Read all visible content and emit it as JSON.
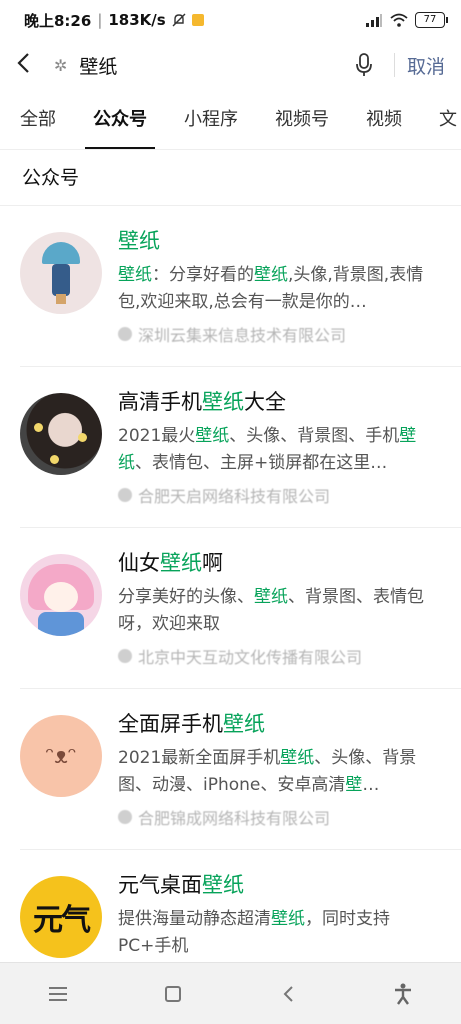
{
  "status_bar": {
    "time": "晚上8:26",
    "network_speed": "183K/s",
    "battery": "77"
  },
  "search": {
    "query": "壁纸",
    "cancel_label": "取消"
  },
  "tabs": [
    {
      "label": "全部",
      "active": false
    },
    {
      "label": "公众号",
      "active": true
    },
    {
      "label": "小程序",
      "active": false
    },
    {
      "label": "视频号",
      "active": false
    },
    {
      "label": "视频",
      "active": false
    },
    {
      "label": "文",
      "active": false
    }
  ],
  "section_title": "公众号",
  "results": [
    {
      "title_pre": "",
      "title_hl": "壁纸",
      "title_post": "",
      "desc_html_parts": [
        [
          "",
          "壁纸"
        ],
        [
          "：分享好看的",
          "壁纸"
        ],
        [
          ",头像,背景图,表情包,欢迎来取,总会有一款是你的…",
          ""
        ]
      ],
      "org": "深圳云集来信息技术有限公司"
    },
    {
      "title_pre": "高清手机",
      "title_hl": "壁纸",
      "title_post": "大全",
      "desc_html_parts": [
        [
          "2021最火",
          "壁纸"
        ],
        [
          "、头像、背景图、手机",
          "壁纸"
        ],
        [
          "、表情包、主屏+锁屏都在这里…",
          ""
        ]
      ],
      "org": "合肥天启网络科技有限公司"
    },
    {
      "title_pre": "仙女",
      "title_hl": "壁纸",
      "title_post": "啊",
      "desc_html_parts": [
        [
          "分享美好的头像、",
          "壁纸"
        ],
        [
          "、背景图、表情包呀，欢迎来取",
          ""
        ]
      ],
      "org": "北京中天互动文化传播有限公司"
    },
    {
      "title_pre": "全面屏手机",
      "title_hl": "壁纸",
      "title_post": "",
      "desc_html_parts": [
        [
          "2021最新全面屏手机",
          "壁纸"
        ],
        [
          "、头像、背景图、动漫、iPhone、安卓高清",
          "壁"
        ],
        [
          "…",
          ""
        ]
      ],
      "org": "合肥锦成网络科技有限公司"
    },
    {
      "title_pre": "元气桌面",
      "title_hl": "壁纸",
      "title_post": "",
      "desc_html_parts": [
        [
          "提供海量动静态超清",
          "壁纸"
        ],
        [
          "，同时支持PC+手机",
          ""
        ]
      ],
      "org": ""
    }
  ],
  "avatar5_text": "元气",
  "colors": {
    "highlight": "#07a35a",
    "cancel": "#576b95"
  }
}
